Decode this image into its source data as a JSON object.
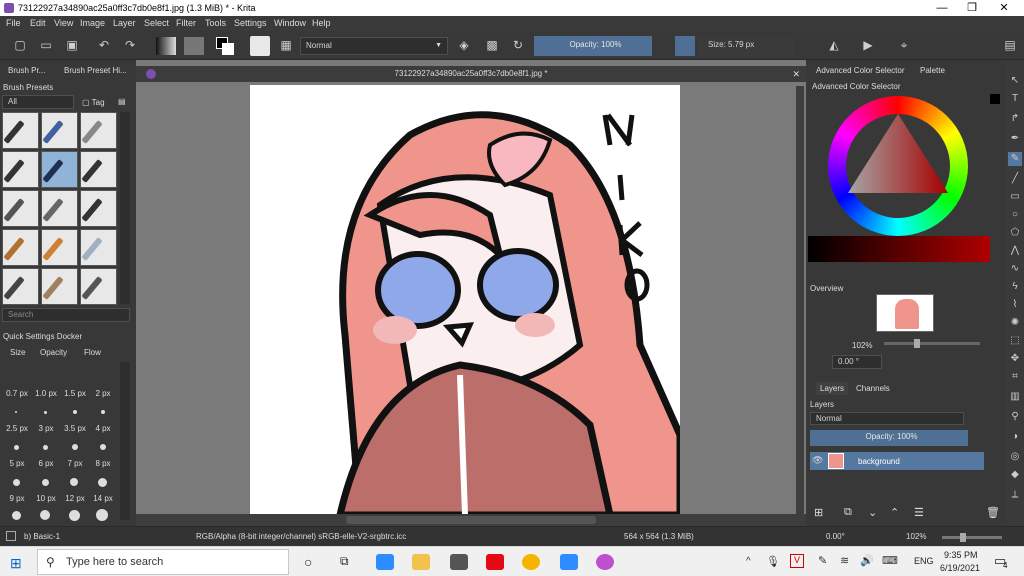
{
  "window": {
    "title": "73122927a34890ac25a0ff3c7db0e8f1.jpg (1.3 MiB)  * - Krita"
  },
  "menu": [
    "File",
    "Edit",
    "View",
    "Image",
    "Layer",
    "Select",
    "Filter",
    "Tools",
    "Settings",
    "Window",
    "Help"
  ],
  "toolbar": {
    "blend_mode": "Normal",
    "opacity": "Opacity: 100%",
    "size": "Size: 5.79 px"
  },
  "left": {
    "tab1": "Brush Pr...",
    "tab2": "Brush Preset Hi...",
    "docker_title": "Brush Presets",
    "filter": "All",
    "tag": "Tag",
    "search_placeholder": "Search",
    "quick_title": "Quick Settings Docker",
    "qs_tabs": [
      "Size",
      "Opacity",
      "Flow"
    ],
    "sizes": [
      "0.7 px",
      "1.0 px",
      "1.5 px",
      "2 px",
      "2.5 px",
      "3 px",
      "3.5 px",
      "4 px",
      "5 px",
      "6 px",
      "7 px",
      "8 px",
      "9 px",
      "10 px",
      "12 px",
      "14 px"
    ]
  },
  "document": {
    "tab_title": "73122927a34890ac25a0ff3c7db0e8f1.jpg *"
  },
  "right": {
    "tab1": "Advanced Color Selector",
    "tab2": "Palette",
    "color_title": "Advanced Color Selector",
    "overview_title": "Overview",
    "zoom": "102%",
    "rotation": "0.00 °",
    "layers_tab": "Layers",
    "channels_tab": "Channels",
    "layers_title": "Layers",
    "layer_mode": "Normal",
    "layer_opacity": "Opacity:  100%",
    "layer_name": "background"
  },
  "status": {
    "brush": "b) Basic-1",
    "color_info": "RGB/Alpha (8-bit integer/channel)  sRGB-elle-V2-srgbtrc.icc",
    "dimensions": "564 x 564 (1.3 MiB)",
    "rotation": "0.00°",
    "zoom": "102%"
  },
  "taskbar": {
    "search_placeholder": "Type here to search",
    "lang": "ENG",
    "time": "9:35 PM",
    "date": "6/19/2021",
    "notif_count": "4"
  }
}
